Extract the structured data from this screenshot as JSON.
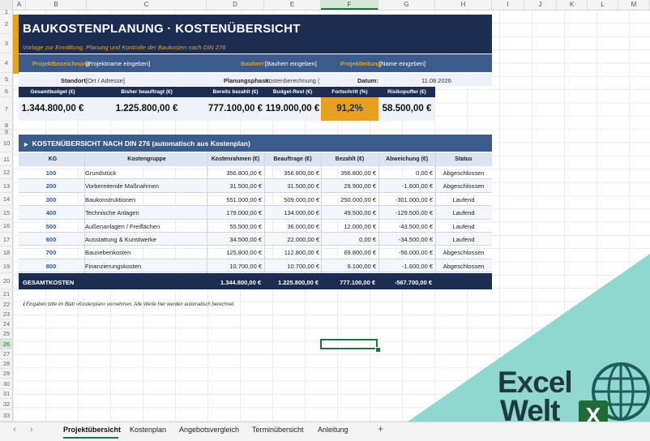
{
  "columns": [
    "A",
    "B",
    "C",
    "D",
    "E",
    "F",
    "G",
    "H",
    "I",
    "J",
    "K",
    "L",
    "M"
  ],
  "selected_column": "F",
  "rows": [
    "1",
    "2",
    "3",
    "4",
    "5",
    "6",
    "7",
    "8",
    "9",
    "10",
    "11",
    "12",
    "13",
    "14",
    "15",
    "16",
    "17",
    "18",
    "19",
    "20",
    "21",
    "22",
    "23",
    "24",
    "25",
    "26",
    "27",
    "28",
    "29",
    "30",
    "31",
    "32",
    "33"
  ],
  "selected_row": "26",
  "header": {
    "title": "BAUKOSTENPLANUNG  ·  KOSTENÜBERSICHT",
    "subtitle": "Vorlage zur Ermittlung, Planung und Kontrolle der Baukosten nach DIN 276"
  },
  "project": {
    "name_label": "Projektbezeichnung:",
    "name_value": "[Projektname eingeben]",
    "client_label": "Bauherr:",
    "client_value": "[Bauherr eingeben]",
    "lead_label": "Projektleitung:",
    "lead_value": "[Name eingeben]"
  },
  "info": {
    "location_label": "Standort:",
    "location_value": "[Ort / Adresse]",
    "phase_label": "Planungsphase:",
    "phase_value": "Kostenberechnung (",
    "date_label": "Datum:",
    "date_value": "11.08.2026"
  },
  "kpis": [
    {
      "label": "Gesamtbudget (€)",
      "value": "1.344.800,00 €"
    },
    {
      "label": "Bisher beauftragt (€)",
      "value": "1.225.800,00 €"
    },
    {
      "label": "Bereits bezahlt (€)",
      "value": "777.100,00 €"
    },
    {
      "label": "Budget-Rest (€)",
      "value": "119.000,00 €"
    },
    {
      "label": "Fortschritt (%)",
      "value": "91,2%"
    },
    {
      "label": "Risikopuffer (€)",
      "value": "58.500,00 €"
    }
  ],
  "colors": {
    "navy": "#1d2d52",
    "blue": "#3a5b8c",
    "accent": "#e8a020",
    "excel_green": "#217346"
  },
  "section": {
    "icon": "triangle-right-icon",
    "title": "KOSTENÜBERSICHT NACH DIN 276  (automatisch aus Kostenplan)"
  },
  "table": {
    "headers": [
      "KG",
      "Kostengruppe",
      "Kostenrahmen (€)",
      "Beauftrage (€)",
      "Bezahlt (€)",
      "Abweichung (€)",
      "Status"
    ],
    "rows": [
      {
        "kg": "100",
        "group": "Grundstück",
        "frame": "356.800,00 €",
        "ordered": "356.800,00 €",
        "paid": "356.800,00 €",
        "dev": "0,00 €",
        "status": "Abgeschlossen"
      },
      {
        "kg": "200",
        "group": "Vorbereitende Maßnahmen",
        "frame": "31.500,00 €",
        "ordered": "31.500,00 €",
        "paid": "29.900,00 €",
        "dev": "-1.600,00 €",
        "status": "Abgeschlossen"
      },
      {
        "kg": "300",
        "group": "Baukonstruktionen",
        "frame": "551.000,00 €",
        "ordered": "509.000,00 €",
        "paid": "250.000,00 €",
        "dev": "-301.000,00 €",
        "status": "Laufend"
      },
      {
        "kg": "400",
        "group": "Technische Anlagen",
        "frame": "179.000,00 €",
        "ordered": "134.000,00 €",
        "paid": "49.500,00 €",
        "dev": "-129.500,00 €",
        "status": "Laufend"
      },
      {
        "kg": "500",
        "group": "Außenanlagen / Freiflächen",
        "frame": "55.500,00 €",
        "ordered": "36.000,00 €",
        "paid": "12.000,00 €",
        "dev": "-43.500,00 €",
        "status": "Laufend"
      },
      {
        "kg": "600",
        "group": "Ausstattung & Kunstwerke",
        "frame": "34.500,00 €",
        "ordered": "22.000,00 €",
        "paid": "0,00 €",
        "dev": "-34.500,00 €",
        "status": "Laufend"
      },
      {
        "kg": "700",
        "group": "Baunebenkosten",
        "frame": "125.800,00 €",
        "ordered": "112.800,00 €",
        "paid": "69.800,00 €",
        "dev": "-56.000,00 €",
        "status": "Abgeschlossen"
      },
      {
        "kg": "800",
        "group": "Finanzierungskosten",
        "frame": "10.700,00 €",
        "ordered": "10.700,00 €",
        "paid": "9.100,00 €",
        "dev": "-1.600,00 €",
        "status": "Abgeschlossen"
      }
    ],
    "total": {
      "label": "GESAMTKOSTEN",
      "frame": "1.344.800,00 €",
      "ordered": "1.225.800,00 €",
      "paid": "777.100,00 €",
      "dev": "-567.700,00 €"
    }
  },
  "footnote": "ℹ Eingaben bitte im Blatt »Kostenplan« vornehmen. Alle Werte hier werden automatisch berechnet.",
  "logo": {
    "line1": "Excel",
    "line2": "Welt",
    "icon": "excel-x-icon"
  },
  "sheet_tabs": [
    "Projektübersicht",
    "Kostenplan",
    "Angebotsvergleich",
    "Terminübersicht",
    "Anleitung"
  ],
  "active_tab": "Projektübersicht",
  "add_sheet": "+"
}
